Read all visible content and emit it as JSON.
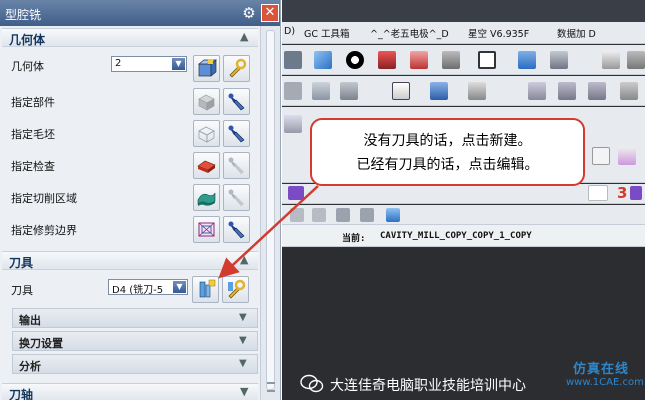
{
  "dialog": {
    "title": "型腔铣",
    "sections": {
      "geometry": {
        "header": "几何体",
        "rows": {
          "geometry_label": "几何体",
          "geometry_value": "2",
          "part_label": "指定部件",
          "blank_label": "指定毛坯",
          "check_label": "指定检查",
          "cut_area_label": "指定切削区域",
          "trim_label": "指定修剪边界"
        }
      },
      "tool": {
        "header": "刀具",
        "tool_label": "刀具",
        "tool_value": "D4 (铣刀-5",
        "subsections": {
          "output": "输出",
          "tool_change": "换刀设置",
          "analysis": "分析"
        }
      },
      "tool_axis": {
        "header": "刀轴"
      }
    }
  },
  "app": {
    "menubar": {
      "gc_toolbox": "GC 工具箱",
      "electrode": "^_^老五电极^_D",
      "xingkong": "星空 V6.935F",
      "plugin": "数据加 D"
    },
    "current_label": "当前:",
    "current_value": "CAVITY_MILL_COPY_COPY_1_COPY",
    "toolbar_number": "3"
  },
  "callout": {
    "line1": "没有刀具的话，点击新建。",
    "line2": "已经有刀具的话，点击编辑。",
    "border_color": "#d23b2e"
  },
  "watermark": {
    "text": "大连佳奇电脑职业技能培训中心",
    "logo_top": "仿真在线",
    "logo_bottom": "www.1CAE.com"
  }
}
